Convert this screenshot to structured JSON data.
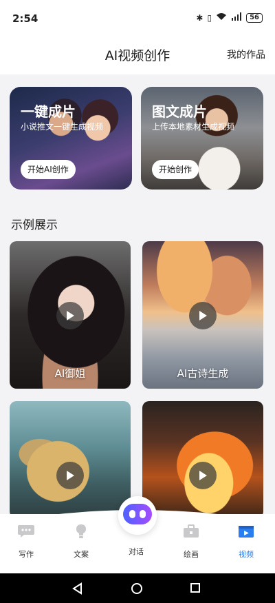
{
  "status": {
    "time": "2:54",
    "battery": "56"
  },
  "header": {
    "title": "AI视频创作",
    "my_works": "我的作品"
  },
  "cards": [
    {
      "title": "一键成片",
      "subtitle": "小说推文一键生成视频",
      "button": "开始AI创作"
    },
    {
      "title": "图文成片",
      "subtitle": "上传本地素材生成视频",
      "button": "开始创作"
    }
  ],
  "examples": {
    "title": "示例展示",
    "items": [
      {
        "label": "AI御姐"
      },
      {
        "label": "AI古诗生成"
      },
      {
        "label": ""
      },
      {
        "label": ""
      }
    ]
  },
  "tabs": [
    {
      "label": "写作",
      "icon": "chat-bubble-icon"
    },
    {
      "label": "文案",
      "icon": "lightbulb-icon"
    },
    {
      "label": "对话",
      "icon": "robot-icon"
    },
    {
      "label": "绘画",
      "icon": "toolbox-icon"
    },
    {
      "label": "视频",
      "icon": "video-icon"
    }
  ],
  "colors": {
    "accent": "#2a7ef0",
    "robot_gradient_start": "#4c62ff",
    "robot_gradient_end": "#a54cff"
  }
}
